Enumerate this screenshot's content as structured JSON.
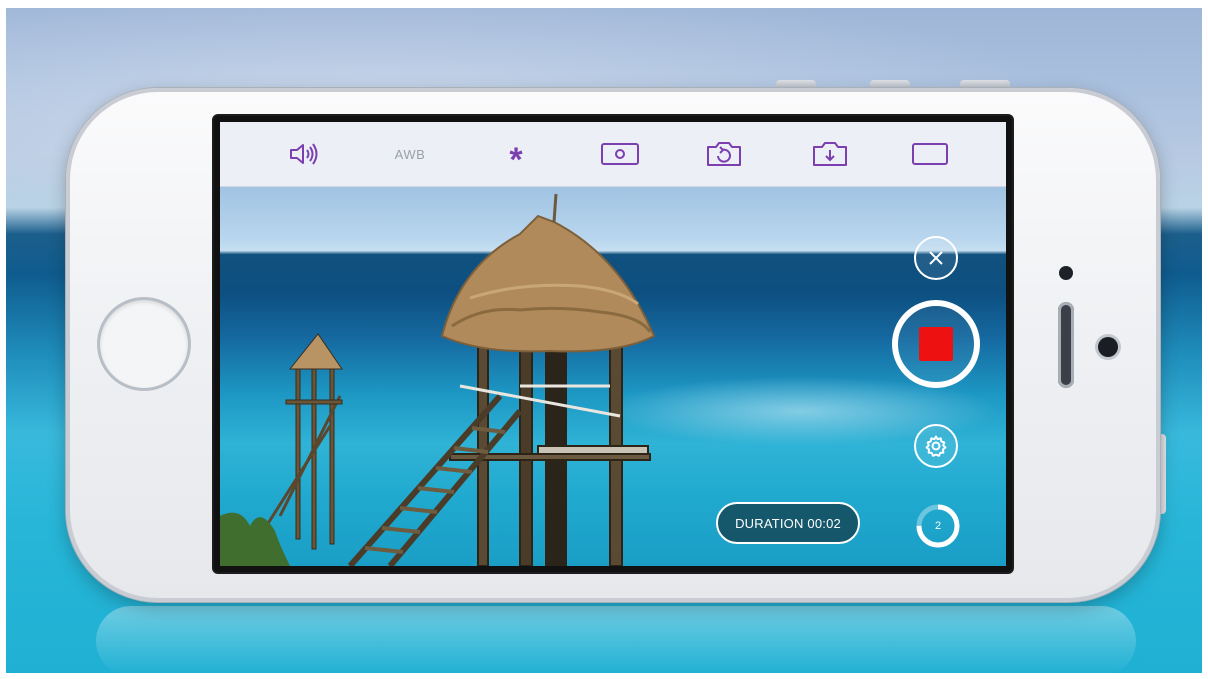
{
  "colors": {
    "accent": "#7b3fb0",
    "record": "#ee1111",
    "toolbar_bg": "#eceff6"
  },
  "toolbar": {
    "items": [
      {
        "name": "sound",
        "icon": "speaker-volume-icon"
      },
      {
        "name": "awb",
        "label": "AWB"
      },
      {
        "name": "focus",
        "icon": "asterisk-icon",
        "label": "*"
      },
      {
        "name": "exposure",
        "icon": "camera-mode-icon"
      },
      {
        "name": "switch-camera",
        "icon": "rotate-camera-icon"
      },
      {
        "name": "save",
        "icon": "download-icon"
      },
      {
        "name": "aspect",
        "icon": "frame-icon"
      }
    ]
  },
  "controls": {
    "close_icon": "close-icon",
    "record_state": "recording",
    "settings_icon": "gear-icon",
    "duration_text": "DURATION 00:02",
    "timer_value": "2",
    "timer_progress": 0.75
  }
}
